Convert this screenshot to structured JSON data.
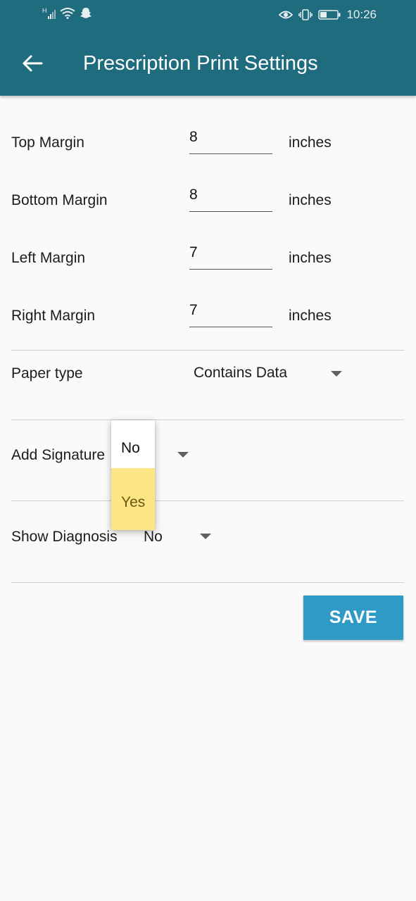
{
  "status_bar": {
    "network_label": "H",
    "time": "10:26"
  },
  "app_bar": {
    "title": "Prescription Print Settings",
    "back_icon": "arrow-left-icon"
  },
  "margins": {
    "unit_label": "inches",
    "rows": [
      {
        "label": "Top Margin",
        "value": "8"
      },
      {
        "label": "Bottom Margin",
        "value": "8"
      },
      {
        "label": "Left Margin",
        "value": "7"
      },
      {
        "label": "Right Margin",
        "value": "7"
      }
    ]
  },
  "paper_type": {
    "label": "Paper type",
    "selected": "Contains Data"
  },
  "add_signature": {
    "label": "Add Signature",
    "dropdown_options": [
      "No",
      "Yes"
    ],
    "highlighted_option": "Yes"
  },
  "show_diagnosis": {
    "label": "Show Diagnosis",
    "selected": "No"
  },
  "save_button": {
    "label": "SAVE"
  },
  "colors": {
    "app_bar": "#1f6c7f",
    "save_button": "#2f9ac5",
    "highlight": "#fce584"
  }
}
